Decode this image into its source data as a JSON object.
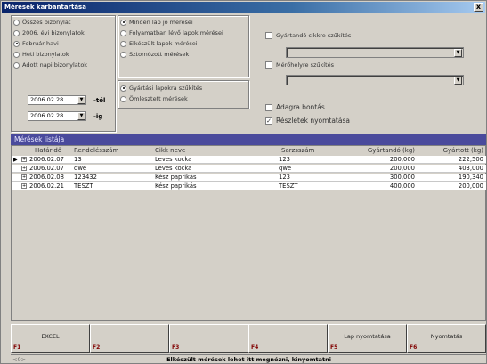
{
  "window": {
    "title": "Mérések karbantartása",
    "close_label": "x"
  },
  "period_options": [
    {
      "label": "Összes bizonylat",
      "selected": false
    },
    {
      "label": "2006. évi bizonylatok",
      "selected": false
    },
    {
      "label": "Február havi",
      "selected": true
    },
    {
      "label": "Heti bizonylatok",
      "selected": false
    },
    {
      "label": "Adott napi bizonylatok",
      "selected": false
    }
  ],
  "date_from": {
    "value": "2006.02.28",
    "suffix": "-tól"
  },
  "date_to": {
    "value": "2006.02.28",
    "suffix": "-ig"
  },
  "sheet_options": [
    {
      "label": "Minden lap jó mérései",
      "selected": true
    },
    {
      "label": "Folyamatban lévő lapok mérései",
      "selected": false
    },
    {
      "label": "Elkészült lapok mérései",
      "selected": false
    },
    {
      "label": "Sztornózott mérések",
      "selected": false
    }
  ],
  "filter_options": [
    {
      "label": "Gyártási lapokra szűkítés",
      "selected": true
    },
    {
      "label": "Ömlesztett mérések",
      "selected": false
    }
  ],
  "right_checks": {
    "product_filter": {
      "label": "Gyártandó cikkre szűkítés",
      "checked": false
    },
    "device_filter": {
      "label": "Mérőhelyre szűkítés",
      "checked": false
    },
    "batch_split": {
      "label": "Adagra bontás",
      "checked": false
    },
    "print_details": {
      "label": "Részletek nyomtatása",
      "checked": true
    }
  },
  "list": {
    "title": "Mérések listája",
    "columns": [
      "Határidő",
      "Rendelésszám",
      "Cikk neve",
      "Sarzsszám",
      "Gyártandó (kg)",
      "Gyártott (kg)"
    ],
    "rows": [
      [
        "2006.02.07",
        "13",
        "Leves kocka",
        "123",
        "200,000",
        "222,500"
      ],
      [
        "2006.02.07",
        "qwe",
        "Leves kocka",
        "qwe",
        "200,000",
        "403,000"
      ],
      [
        "2006.02.08",
        "123432",
        "Kész paprikás",
        "123",
        "300,000",
        "190,340"
      ],
      [
        "2006.02.21",
        "TESZT",
        "Kész paprikás",
        "TESZT",
        "400,000",
        "200,000"
      ]
    ]
  },
  "fkeys": [
    {
      "key": "F1",
      "label": "EXCEL"
    },
    {
      "key": "F2",
      "label": ""
    },
    {
      "key": "F3",
      "label": ""
    },
    {
      "key": "F4",
      "label": ""
    },
    {
      "key": "F5",
      "label": "Lap nyomtatása"
    },
    {
      "key": "F6",
      "label": "Nyomtatás"
    }
  ],
  "status": {
    "left": "<0>",
    "message": "Elkészült mérések lehet itt megnézni, kinyomtatni"
  }
}
